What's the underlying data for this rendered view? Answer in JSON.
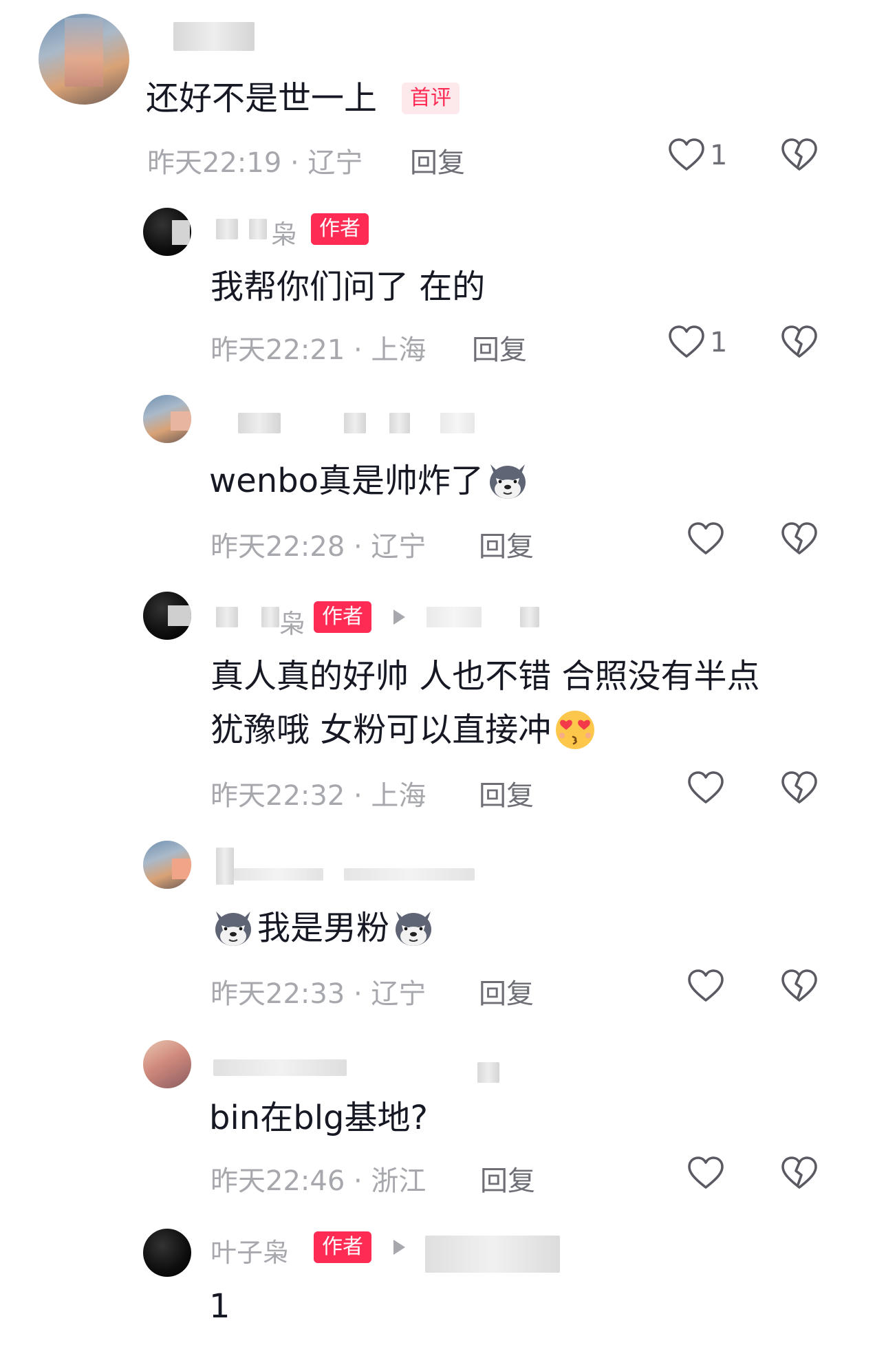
{
  "labels": {
    "reply": "回复",
    "author_badge": "作者",
    "first_badge": "首评"
  },
  "comments": [
    {
      "text": "还好不是世一上",
      "time": "昨天22:19 · 辽宁",
      "likes": "1"
    },
    {
      "name_suffix": "枭",
      "text": "我帮你们问了  在的",
      "time": "昨天22:21 · 上海",
      "likes": "1"
    },
    {
      "text": "wenbo真是帅炸了",
      "time": "昨天22:28 · 辽宁"
    },
    {
      "name_suffix": "枭",
      "text_line1": "真人真的好帅  人也不错 合照没有半点",
      "text_line2": "犹豫哦  女粉可以直接冲",
      "time": "昨天22:32 · 上海"
    },
    {
      "text": "我是男粉",
      "time": "昨天22:33 · 辽宁"
    },
    {
      "text": "bin在blg基地?",
      "time": "昨天22:46 · 浙江"
    },
    {
      "name": "叶子枭",
      "text": "1"
    }
  ],
  "icons": {
    "like": "heart-outline-icon",
    "dislike": "broken-heart-icon",
    "wolf_emoji": "wolf-face-emoji",
    "love_emoji": "heart-eyes-kiss-emoji",
    "reply_arrow": "play-arrow-icon"
  }
}
